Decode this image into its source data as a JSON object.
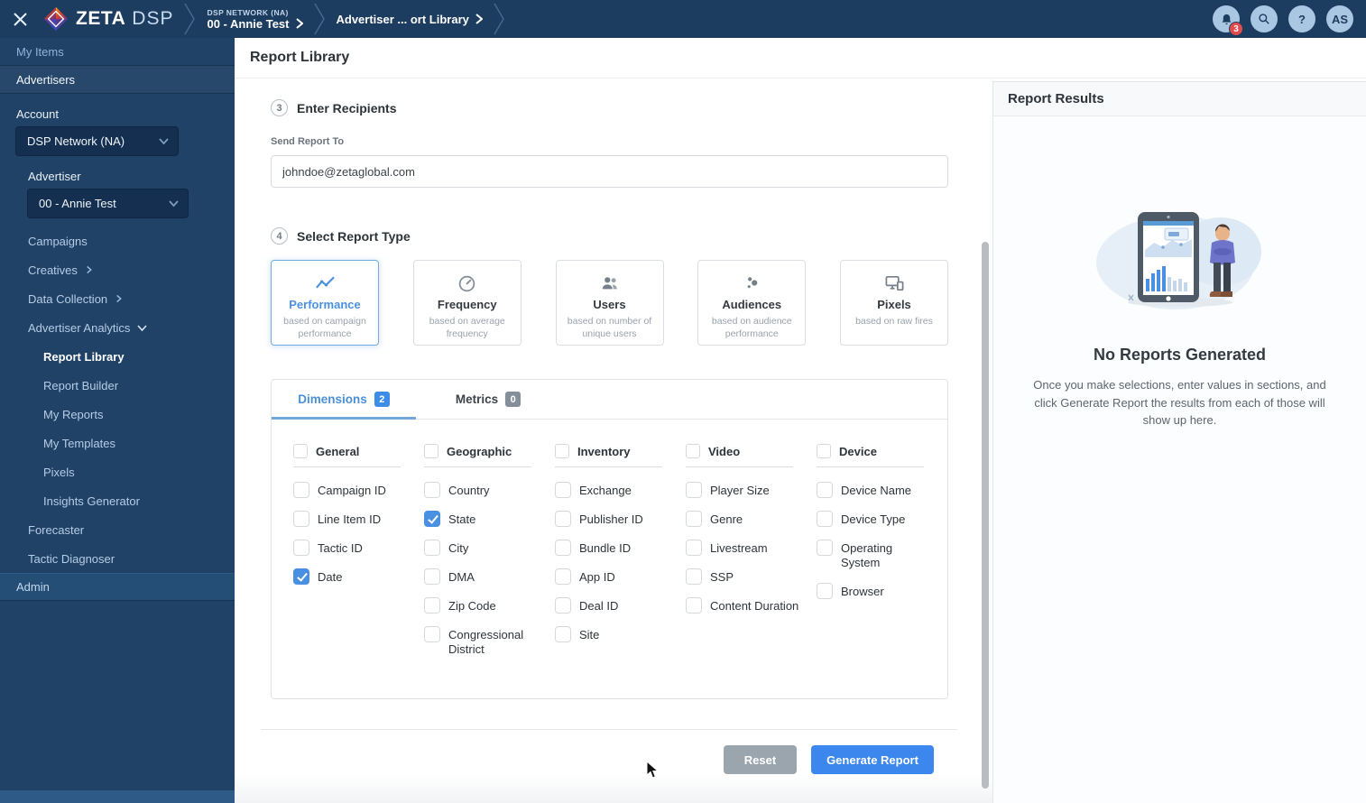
{
  "topbar": {
    "brand_zeta": "ZETA",
    "brand_dsp": "DSP",
    "breadcrumb_network": "DSP NETWORK (NA)",
    "breadcrumb_advertiser": "00 - Annie Test",
    "breadcrumb_page": "Advertiser ... ort Library",
    "notification_count": "3",
    "help_label": "?",
    "avatar_initials": "AS"
  },
  "sidebar": {
    "my_items_label": "My Items",
    "advertisers_label": "Advertisers",
    "account_label": "Account",
    "account_value": "DSP Network (NA)",
    "advertiser_label": "Advertiser",
    "advertiser_value": "00 - Annie Test",
    "menu": [
      {
        "label": "Campaigns"
      },
      {
        "label": "Creatives",
        "chevron": "right"
      },
      {
        "label": "Data Collection",
        "chevron": "right"
      },
      {
        "label": "Advertiser Analytics",
        "chevron": "down"
      }
    ],
    "analytics_items": [
      {
        "label": "Report Library",
        "active": true
      },
      {
        "label": "Report Builder"
      },
      {
        "label": "My Reports"
      },
      {
        "label": "My Templates"
      },
      {
        "label": "Pixels"
      },
      {
        "label": "Insights Generator"
      }
    ],
    "bottom_menu": [
      {
        "label": "Forecaster"
      },
      {
        "label": "Tactic Diagnoser"
      }
    ],
    "admin_label": "Admin"
  },
  "main": {
    "page_title": "Report Library",
    "recipients": {
      "step": "3",
      "title": "Enter Recipients",
      "field_label": "Send Report To",
      "value": "johndoe@zetaglobal.com"
    },
    "report_type_step": {
      "step": "4",
      "title": "Select Report Type"
    },
    "report_types": [
      {
        "name": "Performance",
        "desc": "based on campaign performance",
        "icon": "performance-icon",
        "selected": true
      },
      {
        "name": "Frequency",
        "desc": "based on average frequency",
        "icon": "frequency-icon"
      },
      {
        "name": "Users",
        "desc": "based on number of unique users",
        "icon": "users-icon"
      },
      {
        "name": "Audiences",
        "desc": "based on audience performance",
        "icon": "audiences-icon"
      },
      {
        "name": "Pixels",
        "desc": "based on raw fires",
        "icon": "pixels-icon"
      }
    ],
    "tabs": [
      {
        "label": "Dimensions",
        "count": "2",
        "active": true
      },
      {
        "label": "Metrics",
        "count": "0"
      }
    ],
    "dimension_groups": [
      {
        "name": "General",
        "items": [
          {
            "label": "Campaign ID"
          },
          {
            "label": "Line Item ID"
          },
          {
            "label": "Tactic ID"
          },
          {
            "label": "Date",
            "checked": true
          }
        ]
      },
      {
        "name": "Geographic",
        "items": [
          {
            "label": "Country"
          },
          {
            "label": "State",
            "checked": true
          },
          {
            "label": "City"
          },
          {
            "label": "DMA"
          },
          {
            "label": "Zip Code"
          },
          {
            "label": "Congressional District"
          }
        ]
      },
      {
        "name": "Inventory",
        "items": [
          {
            "label": "Exchange"
          },
          {
            "label": "Publisher ID"
          },
          {
            "label": "Bundle ID"
          },
          {
            "label": "App ID"
          },
          {
            "label": "Deal ID"
          },
          {
            "label": "Site"
          }
        ]
      },
      {
        "name": "Video",
        "items": [
          {
            "label": "Player Size"
          },
          {
            "label": "Genre"
          },
          {
            "label": "Livestream"
          },
          {
            "label": "SSP"
          },
          {
            "label": "Content Duration"
          }
        ]
      },
      {
        "name": "Device",
        "items": [
          {
            "label": "Device Name"
          },
          {
            "label": "Device Type"
          },
          {
            "label": "Operating System"
          },
          {
            "label": "Browser"
          }
        ]
      }
    ],
    "buttons": {
      "reset": "Reset",
      "generate": "Generate Report"
    }
  },
  "results": {
    "title": "Report Results",
    "empty_title": "No Reports Generated",
    "empty_text": "Once you make selections, enter values in sections, and click Generate Report the results from each of those will show up here."
  },
  "colors": {
    "accent_blue": "#4a90e2",
    "topbar_navy": "#1d3d60",
    "sidebar_navy": "#1f4266",
    "button_blue": "#3b87ee",
    "reset_gray": "#9aa5ae",
    "badge_red": "#e14b4b",
    "tab_badge_gray": "#858f99",
    "tab_badge_blue": "#3d8ce8"
  }
}
